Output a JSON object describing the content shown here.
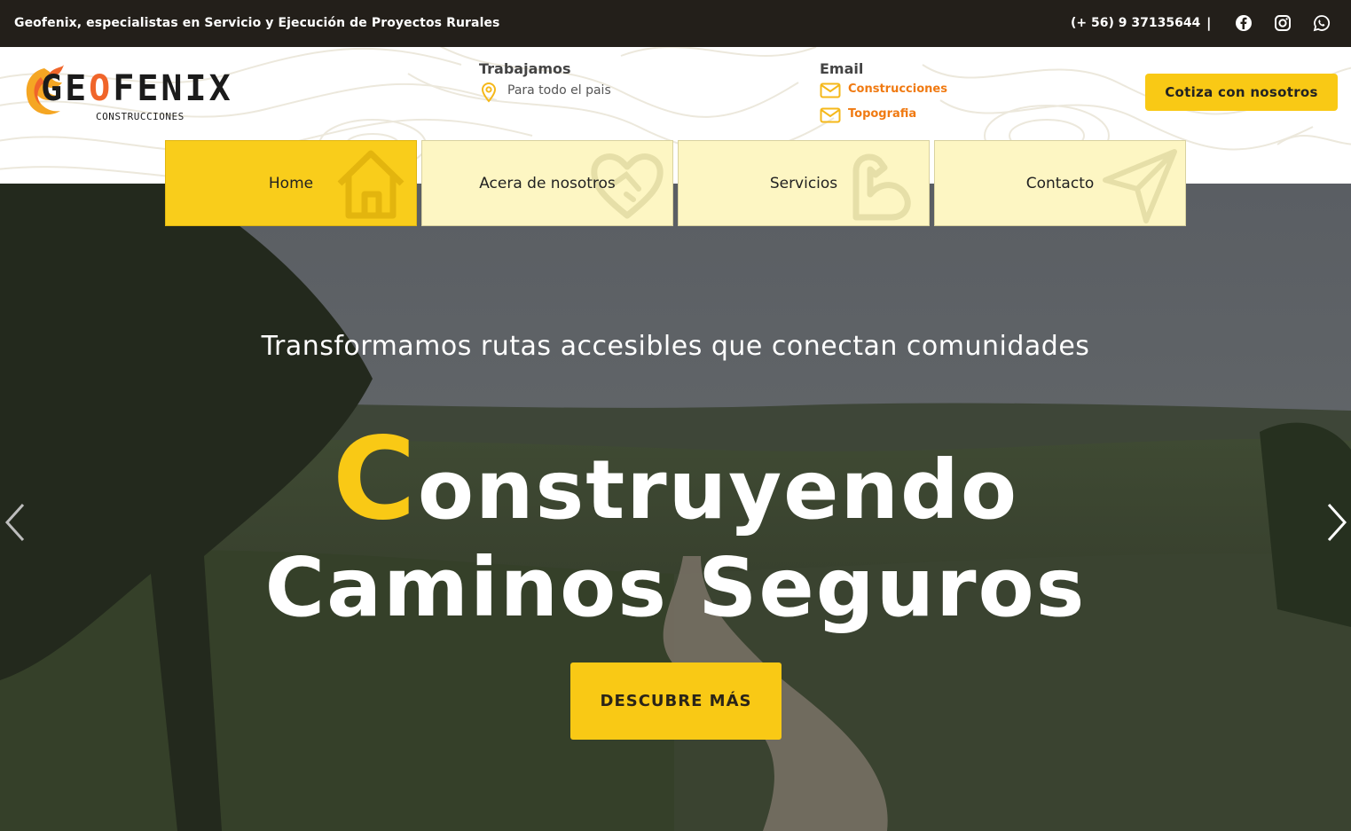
{
  "topbar": {
    "tagline": "Geofenix, especialistas en Servicio y Ejecución de Proyectos Rurales",
    "phone": "(+ 56) 9 37135644",
    "separator": "|",
    "social_icons": [
      "facebook-icon",
      "instagram-icon",
      "whatsapp-icon"
    ]
  },
  "header": {
    "logo": {
      "brand_start": "GE",
      "brand_accent": "O",
      "brand_end": "FENIX",
      "subtitle": "CONSTRUCCIONES"
    },
    "work": {
      "title": "Trabajamos",
      "text": "Para todo el pais",
      "icon": "location-pin-icon"
    },
    "email": {
      "title": "Email",
      "links": [
        "Construcciones",
        "Topografia"
      ],
      "icon": "mail-icon"
    },
    "cta_label": "Cotiza con nosotros"
  },
  "nav": {
    "tabs": [
      {
        "label": "Home",
        "icon": "home-icon",
        "active": true
      },
      {
        "label": "Acera de nosotros",
        "icon": "heart-handshake-icon",
        "active": false
      },
      {
        "label": "Servicios",
        "icon": "muscle-icon",
        "active": false
      },
      {
        "label": "Contacto",
        "icon": "paper-plane-icon",
        "active": false
      }
    ]
  },
  "hero": {
    "subtitle": "Transformamos rutas accesibles que conectan comunidades",
    "title_first_letter": "C",
    "title_line1_rest": "onstruyendo",
    "title_line2": "Caminos Seguros",
    "button_label": "DESCUBRE MÁS",
    "prev_icon": "chevron-left-icon",
    "next_icon": "chevron-right-icon"
  },
  "colors": {
    "accent": "#f9c915",
    "orange": "#f07a12",
    "dark": "#231f1a",
    "tab_inactive": "#fdf6c3"
  }
}
